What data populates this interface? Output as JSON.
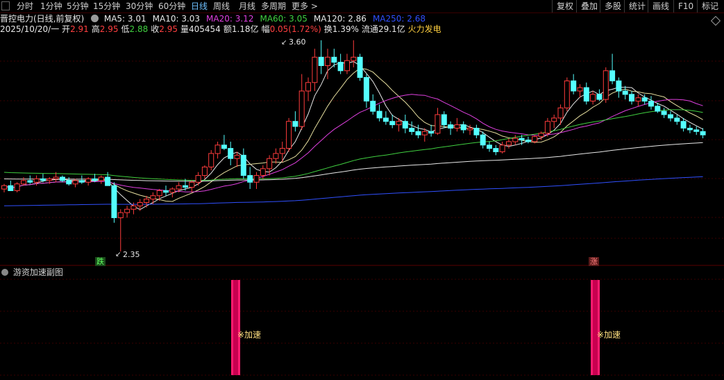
{
  "toolbar": {
    "periods": [
      "分时",
      "1分钟",
      "5分钟",
      "15分钟",
      "30分钟",
      "60分钟",
      "日线",
      "周线",
      "月线",
      "多周期",
      "更多 >"
    ],
    "active": "日线",
    "right": [
      "复权",
      "叠加",
      "多股",
      "统计",
      "画线",
      "F10",
      "标记"
    ]
  },
  "header": {
    "stock": "晋控电力(日线,前复权)",
    "ma": [
      {
        "label": "MA5: 3.01",
        "color": "#e8e8e8"
      },
      {
        "label": "MA10: 3.03",
        "color": "#e8e8e8"
      },
      {
        "label": "MA20: 3.12",
        "color": "#e040e0"
      },
      {
        "label": "MA60: 3.05",
        "color": "#40d040"
      },
      {
        "label": "MA120: 2.86",
        "color": "#e8e8e8"
      },
      {
        "label": "MA250: 2.68",
        "color": "#3050ff"
      }
    ],
    "date": "2025/10/20/一",
    "quote": [
      {
        "label": "开",
        "value": "2.91",
        "color": "#ff4040"
      },
      {
        "label": "高",
        "value": "2.95",
        "color": "#ff4040"
      },
      {
        "label": "低",
        "value": "2.88",
        "color": "#40d040"
      },
      {
        "label": "收",
        "value": "2.95",
        "color": "#ff4040"
      },
      {
        "label": "量",
        "value": "405454",
        "color": "#e8e8e8"
      },
      {
        "label": "额",
        "value": "1.18亿",
        "color": "#e8e8e8"
      },
      {
        "label": "幅",
        "value": "0.05(1.72%)",
        "color": "#ff4040"
      },
      {
        "label": "换",
        "value": "1.39%",
        "color": "#e8e8e8"
      },
      {
        "label": "流通",
        "value": "29.1亿",
        "color": "#e8e8e8"
      },
      {
        "label": "",
        "value": "火力发电",
        "color": "#ffd040"
      }
    ]
  },
  "annotations": {
    "high": "3.60",
    "low": "2.35",
    "fall": "跌",
    "rise": "涨"
  },
  "subchart": {
    "title": "游资加速副图",
    "label1": "※加速",
    "label2": "※加速"
  },
  "colors": {
    "up": "#ff3c3c",
    "down": "#54ffff",
    "bar": "#ff1a6e"
  },
  "chart_data": {
    "type": "candlestick",
    "ohlc": [
      [
        2.72,
        2.75,
        2.7,
        2.74
      ],
      [
        2.74,
        2.77,
        2.72,
        2.71
      ],
      [
        2.71,
        2.76,
        2.7,
        2.75
      ],
      [
        2.75,
        2.79,
        2.74,
        2.77
      ],
      [
        2.77,
        2.8,
        2.75,
        2.76
      ],
      [
        2.76,
        2.8,
        2.74,
        2.78
      ],
      [
        2.78,
        2.81,
        2.76,
        2.77
      ],
      [
        2.77,
        2.79,
        2.75,
        2.78
      ],
      [
        2.78,
        2.82,
        2.76,
        2.79
      ],
      [
        2.79,
        2.8,
        2.76,
        2.77
      ],
      [
        2.77,
        2.79,
        2.74,
        2.75
      ],
      [
        2.75,
        2.78,
        2.73,
        2.77
      ],
      [
        2.77,
        2.8,
        2.75,
        2.76
      ],
      [
        2.76,
        2.79,
        2.74,
        2.78
      ],
      [
        2.78,
        2.81,
        2.76,
        2.77
      ],
      [
        2.77,
        2.8,
        2.75,
        2.79
      ],
      [
        2.79,
        2.82,
        2.76,
        2.74
      ],
      [
        2.74,
        2.76,
        2.52,
        2.55
      ],
      [
        2.55,
        2.6,
        2.35,
        2.58
      ],
      [
        2.58,
        2.62,
        2.55,
        2.6
      ],
      [
        2.6,
        2.64,
        2.57,
        2.62
      ],
      [
        2.62,
        2.66,
        2.59,
        2.64
      ],
      [
        2.64,
        2.68,
        2.61,
        2.66
      ],
      [
        2.66,
        2.7,
        2.63,
        2.68
      ],
      [
        2.68,
        2.72,
        2.65,
        2.71
      ],
      [
        2.71,
        2.74,
        2.68,
        2.7
      ],
      [
        2.7,
        2.73,
        2.67,
        2.72
      ],
      [
        2.72,
        2.76,
        2.7,
        2.74
      ],
      [
        2.74,
        2.78,
        2.71,
        2.73
      ],
      [
        2.73,
        2.77,
        2.7,
        2.76
      ],
      [
        2.76,
        2.82,
        2.74,
        2.8
      ],
      [
        2.8,
        2.86,
        2.78,
        2.85
      ],
      [
        2.85,
        2.95,
        2.83,
        2.93
      ],
      [
        2.93,
        3.0,
        2.9,
        2.98
      ],
      [
        2.98,
        3.04,
        2.95,
        2.96
      ],
      [
        2.96,
        3.0,
        2.86,
        2.9
      ],
      [
        2.9,
        2.94,
        2.85,
        2.92
      ],
      [
        2.92,
        2.96,
        2.78,
        2.8
      ],
      [
        2.8,
        2.85,
        2.72,
        2.76
      ],
      [
        2.76,
        2.82,
        2.72,
        2.8
      ],
      [
        2.8,
        2.86,
        2.78,
        2.84
      ],
      [
        2.84,
        2.92,
        2.8,
        2.9
      ],
      [
        2.9,
        2.96,
        2.87,
        2.93
      ],
      [
        2.93,
        3.0,
        2.88,
        2.96
      ],
      [
        2.96,
        3.14,
        2.94,
        3.12
      ],
      [
        3.12,
        3.18,
        3.06,
        3.09
      ],
      [
        3.09,
        3.4,
        3.07,
        3.3
      ],
      [
        3.3,
        3.38,
        3.24,
        3.35
      ],
      [
        3.35,
        3.55,
        3.3,
        3.5
      ],
      [
        3.5,
        3.6,
        3.4,
        3.45
      ],
      [
        3.45,
        3.55,
        3.37,
        3.5
      ],
      [
        3.5,
        3.55,
        3.44,
        3.47
      ],
      [
        3.47,
        3.52,
        3.4,
        3.42
      ],
      [
        3.42,
        3.52,
        3.4,
        3.48
      ],
      [
        3.48,
        3.6,
        3.44,
        3.5
      ],
      [
        3.5,
        3.52,
        3.36,
        3.38
      ],
      [
        3.38,
        3.4,
        3.2,
        3.24
      ],
      [
        3.24,
        3.28,
        3.16,
        3.18
      ],
      [
        3.18,
        3.22,
        3.12,
        3.14
      ],
      [
        3.14,
        3.18,
        3.1,
        3.12
      ],
      [
        3.12,
        3.16,
        3.08,
        3.1
      ],
      [
        3.1,
        3.14,
        3.06,
        3.12
      ],
      [
        3.12,
        3.16,
        3.05,
        3.08
      ],
      [
        3.08,
        3.12,
        3.04,
        3.06
      ],
      [
        3.06,
        3.1,
        3.02,
        3.04
      ],
      [
        3.04,
        3.08,
        3.0,
        3.06
      ],
      [
        3.06,
        3.1,
        3.03,
        3.05
      ],
      [
        3.05,
        3.2,
        3.04,
        3.16
      ],
      [
        3.16,
        3.18,
        3.08,
        3.1
      ],
      [
        3.1,
        3.12,
        3.04,
        3.08
      ],
      [
        3.08,
        3.14,
        3.06,
        3.1
      ],
      [
        3.1,
        3.12,
        3.05,
        3.07
      ],
      [
        3.07,
        3.1,
        3.04,
        3.08
      ],
      [
        3.08,
        3.1,
        3.02,
        3.04
      ],
      [
        3.04,
        3.06,
        2.96,
        2.98
      ],
      [
        2.98,
        3.0,
        2.94,
        2.96
      ],
      [
        2.96,
        2.98,
        2.92,
        2.94
      ],
      [
        2.94,
        3.0,
        2.93,
        2.98
      ],
      [
        2.98,
        3.02,
        2.96,
        3.0
      ],
      [
        3.0,
        3.04,
        2.98,
        3.02
      ],
      [
        3.02,
        3.04,
        2.98,
        3.01
      ],
      [
        3.01,
        3.03,
        2.99,
        3.0
      ],
      [
        3.0,
        3.04,
        2.99,
        3.03
      ],
      [
        3.03,
        3.06,
        3.01,
        3.05
      ],
      [
        3.05,
        3.14,
        3.03,
        3.12
      ],
      [
        3.12,
        3.16,
        3.08,
        3.14
      ],
      [
        3.14,
        3.22,
        3.1,
        3.2
      ],
      [
        3.2,
        3.38,
        3.18,
        3.36
      ],
      [
        3.36,
        3.4,
        3.28,
        3.3
      ],
      [
        3.3,
        3.34,
        3.26,
        3.32
      ],
      [
        3.32,
        3.35,
        3.22,
        3.24
      ],
      [
        3.24,
        3.3,
        3.22,
        3.28
      ],
      [
        3.28,
        3.31,
        3.24,
        3.25
      ],
      [
        3.25,
        3.44,
        3.23,
        3.42
      ],
      [
        3.42,
        3.52,
        3.34,
        3.36
      ],
      [
        3.36,
        3.38,
        3.26,
        3.3
      ],
      [
        3.3,
        3.33,
        3.25,
        3.28
      ],
      [
        3.28,
        3.3,
        3.22,
        3.24
      ],
      [
        3.24,
        3.28,
        3.21,
        3.26
      ],
      [
        3.26,
        3.28,
        3.22,
        3.24
      ],
      [
        3.24,
        3.27,
        3.19,
        3.21
      ],
      [
        3.21,
        3.23,
        3.17,
        3.18
      ],
      [
        3.18,
        3.2,
        3.14,
        3.16
      ],
      [
        3.16,
        3.18,
        3.12,
        3.14
      ],
      [
        3.14,
        3.16,
        3.1,
        3.12
      ],
      [
        3.12,
        3.14,
        3.06,
        3.08
      ],
      [
        3.08,
        3.1,
        3.05,
        3.07
      ],
      [
        3.07,
        3.09,
        3.04,
        3.06
      ],
      [
        3.06,
        3.08,
        3.02,
        3.04
      ]
    ],
    "ma_series": [
      {
        "name": "MA5",
        "color": "#e8e8e8"
      },
      {
        "name": "MA10",
        "color": "#e8e0a0"
      },
      {
        "name": "MA20",
        "color": "#e040e0"
      },
      {
        "name": "MA60",
        "color": "#40d040"
      },
      {
        "name": "MA120",
        "color": "#e8e8e8"
      },
      {
        "name": "MA250",
        "color": "#3050ff"
      }
    ],
    "ylim": [
      2.3,
      3.7
    ],
    "signals": [
      {
        "index": 19,
        "label": "加速"
      },
      {
        "index": 99,
        "label": "加速"
      }
    ]
  }
}
